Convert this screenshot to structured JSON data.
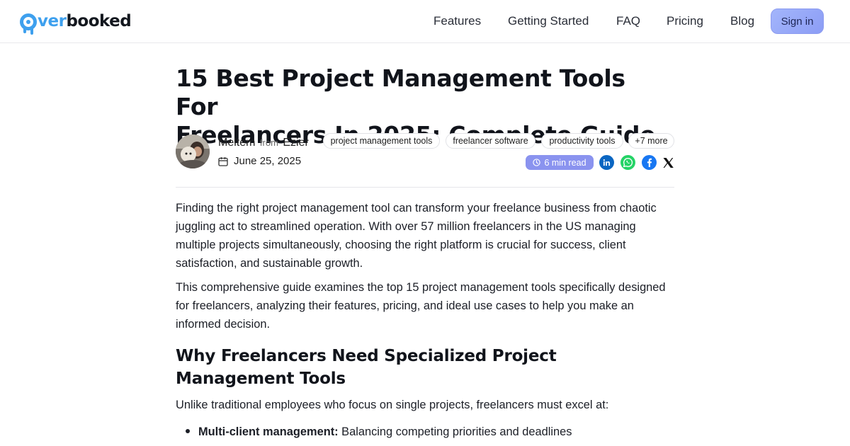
{
  "header": {
    "logo": {
      "prefix": "ver",
      "suffix": "booked"
    },
    "nav": [
      {
        "label": "Features"
      },
      {
        "label": "Getting Started"
      },
      {
        "label": "FAQ"
      },
      {
        "label": "Pricing"
      },
      {
        "label": "Blog"
      }
    ],
    "signin_label": "Sign in"
  },
  "article": {
    "title_line1": "15 Best Project Management Tools For",
    "title_line2": "Freelancers In 2025: Complete Guide",
    "author": {
      "name": "Meltem",
      "from": "from",
      "org": "Ezier"
    },
    "date": "June 25, 2025",
    "tags": [
      {
        "label": "project management tools"
      },
      {
        "label": "freelancer software"
      },
      {
        "label": "productivity tools"
      },
      {
        "label": "+7 more"
      }
    ],
    "read_time": "6 min read",
    "share_icons": [
      "linkedin-icon",
      "whatsapp-icon",
      "facebook-icon",
      "x-icon"
    ],
    "paragraphs": [
      "Finding the right project management tool can transform your freelance business from chaotic juggling act to streamlined operation. With over 57 million freelancers in the US managing multiple projects simultaneously, choosing the right platform is crucial for success, client satisfaction, and sustainable growth.",
      "This comprehensive guide examines the top 15 project management tools specifically designed for freelancers, analyzing their features, pricing, and ideal use cases to help you make an informed decision."
    ],
    "h2": "Why Freelancers Need Specialized Project Management Tools",
    "intro": "Unlike traditional employees who focus on single projects, freelancers must excel at:",
    "list": [
      {
        "bold": "Multi-client management:",
        "text": " Balancing competing priorities and deadlines"
      }
    ]
  },
  "colors": {
    "brand_blue": "#3ea0ee",
    "signin_bg": "#98a9f8",
    "read_badge": "#8a93ef",
    "linkedin": "#0a66c2",
    "whatsapp": "#25d366",
    "facebook": "#1877f2"
  }
}
